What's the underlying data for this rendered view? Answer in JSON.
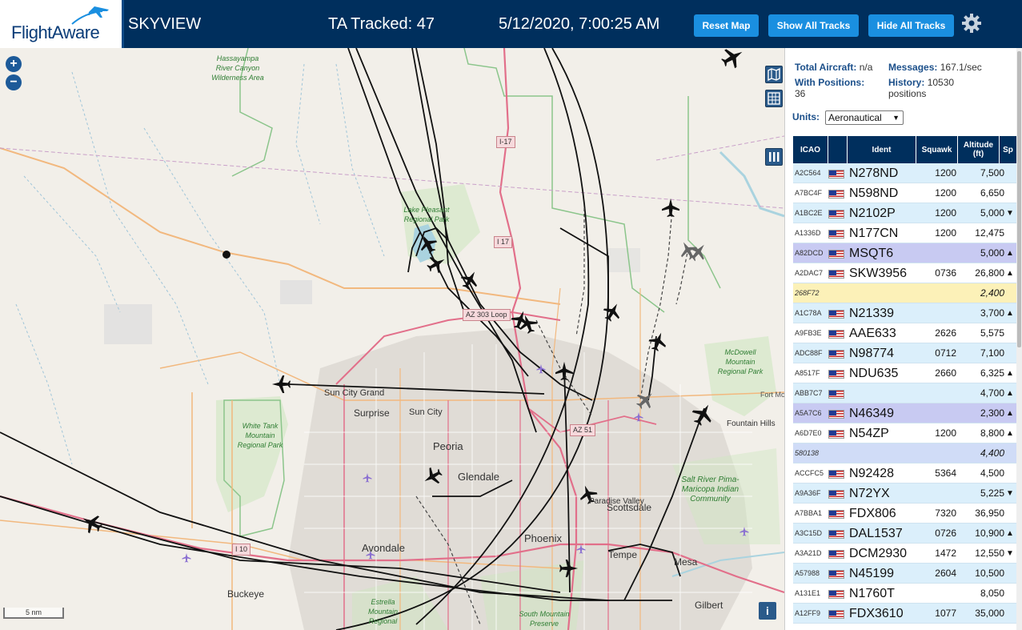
{
  "header": {
    "logo_text": "FlightAware",
    "app_title": "SKYVIEW",
    "tracked_label": "TA Tracked: 47",
    "clock": "5/12/2020, 7:00:25 AM",
    "buttons": {
      "reset": "Reset Map",
      "show_all": "Show All Tracks",
      "hide_all": "Hide All Tracks"
    },
    "icons": {
      "settings": "gear-icon",
      "logo": "airplane-icon"
    }
  },
  "map": {
    "zoom_in": "+",
    "zoom_out": "−",
    "scale_label": "5 nm",
    "info_label": "i",
    "places": {
      "sun_city_grand": "Sun City Grand",
      "sun_city": "Sun City",
      "surprise": "Surprise",
      "peoria": "Peoria",
      "glendale": "Glendale",
      "avondale": "Avondale",
      "phoenix": "Phoenix",
      "tempe": "Tempe",
      "mesa": "Mesa",
      "scottsdale": "Scottsdale",
      "paradise_valley": "Paradise Valley",
      "fountain_hills": "Fountain Hills",
      "buckeye": "Buckeye",
      "gilbert": "Gilbert",
      "fort_mc": "Fort Mc"
    },
    "parks": {
      "hassayampa": "Hassayampa River Canyon Wilderness Area",
      "lake_pleasant": "Lake Pleasant Regional Park",
      "white_tank": "White Tank Mountain Regional Park",
      "mcdowell": "McDowell Mountain Regional Park",
      "salt_river": "Salt River Pima-Maricopa Indian Community",
      "estrella": "Estrella Mountain Regional",
      "south_mountain": "South Mountain Preserve"
    },
    "shields": {
      "i17_a": "I-17",
      "i17_b": "I 17",
      "az303": "AZ 303 Loop",
      "az51": "AZ 51",
      "i10": "I 10"
    }
  },
  "stats": {
    "total_aircraft_label": "Total Aircraft:",
    "total_aircraft_value": "n/a",
    "messages_label": "Messages:",
    "messages_value": "167.1/sec",
    "with_positions_label": "With Positions:",
    "with_positions_value": "36",
    "history_label": "History:",
    "history_value": "10530",
    "history_unit": "positions"
  },
  "units": {
    "label": "Units:",
    "selected": "Aeronautical"
  },
  "table": {
    "columns": [
      "ICAO",
      "",
      "Ident",
      "Squawk",
      "Altitude (ft)",
      "Sp"
    ],
    "rows": [
      {
        "icao": "A2C564",
        "ident": "N278ND",
        "squawk": "1200",
        "alt": "7,500",
        "trend": "",
        "style": "even"
      },
      {
        "icao": "A7BC4F",
        "ident": "N598ND",
        "squawk": "1200",
        "alt": "6,650",
        "trend": "",
        "style": "odd"
      },
      {
        "icao": "A1BC2E",
        "ident": "N2102P",
        "squawk": "1200",
        "alt": "5,000",
        "trend": "▼",
        "style": "even"
      },
      {
        "icao": "A1336D",
        "ident": "N177CN",
        "squawk": "1200",
        "alt": "12,475",
        "trend": "",
        "style": "odd"
      },
      {
        "icao": "A82DCD",
        "ident": "MSQT6",
        "squawk": "",
        "alt": "5,000",
        "trend": "▲",
        "style": "sel"
      },
      {
        "icao": "A2DAC7",
        "ident": "SKW3956",
        "squawk": "0736",
        "alt": "26,800",
        "trend": "▲",
        "style": "odd"
      },
      {
        "icao": "268F72",
        "ident": "",
        "squawk": "",
        "alt": "2,400",
        "trend": "",
        "style": "yel"
      },
      {
        "icao": "A1C78A",
        "ident": "N21339",
        "squawk": "",
        "alt": "3,700",
        "trend": "▲",
        "style": "even"
      },
      {
        "icao": "A9FB3E",
        "ident": "AAE633",
        "squawk": "2626",
        "alt": "5,575",
        "trend": "",
        "style": "odd"
      },
      {
        "icao": "ADC88F",
        "ident": "N98774",
        "squawk": "0712",
        "alt": "7,100",
        "trend": "",
        "style": "even"
      },
      {
        "icao": "A8517F",
        "ident": "NDU635",
        "squawk": "2660",
        "alt": "6,325",
        "trend": "▲",
        "style": "odd"
      },
      {
        "icao": "ABB7C7",
        "ident": "",
        "squawk": "",
        "alt": "4,700",
        "trend": "▲",
        "style": "even"
      },
      {
        "icao": "A5A7C6",
        "ident": "N46349",
        "squawk": "",
        "alt": "2,300",
        "trend": "▲",
        "style": "sel"
      },
      {
        "icao": "A6D7E0",
        "ident": "N54ZP",
        "squawk": "1200",
        "alt": "8,800",
        "trend": "▲",
        "style": "odd"
      },
      {
        "icao": "580138",
        "ident": "",
        "squawk": "",
        "alt": "4,400",
        "trend": "",
        "style": "mlat"
      },
      {
        "icao": "ACCFC5",
        "ident": "N92428",
        "squawk": "5364",
        "alt": "4,500",
        "trend": "",
        "style": "odd"
      },
      {
        "icao": "A9A36F",
        "ident": "N72YX",
        "squawk": "",
        "alt": "5,225",
        "trend": "▼",
        "style": "even"
      },
      {
        "icao": "A7BBA1",
        "ident": "FDX806",
        "squawk": "7320",
        "alt": "36,950",
        "trend": "",
        "style": "odd"
      },
      {
        "icao": "A3C15D",
        "ident": "DAL1537",
        "squawk": "0726",
        "alt": "10,900",
        "trend": "▲",
        "style": "even"
      },
      {
        "icao": "A3A21D",
        "ident": "DCM2930",
        "squawk": "1472",
        "alt": "12,550",
        "trend": "▼",
        "style": "odd"
      },
      {
        "icao": "A57988",
        "ident": "N45199",
        "squawk": "2604",
        "alt": "10,500",
        "trend": "",
        "style": "even"
      },
      {
        "icao": "A131E1",
        "ident": "N1760T",
        "squawk": "",
        "alt": "8,050",
        "trend": "",
        "style": "odd"
      },
      {
        "icao": "A12FF9",
        "ident": "FDX3610",
        "squawk": "1077",
        "alt": "35,000",
        "trend": "",
        "style": "even"
      }
    ]
  }
}
